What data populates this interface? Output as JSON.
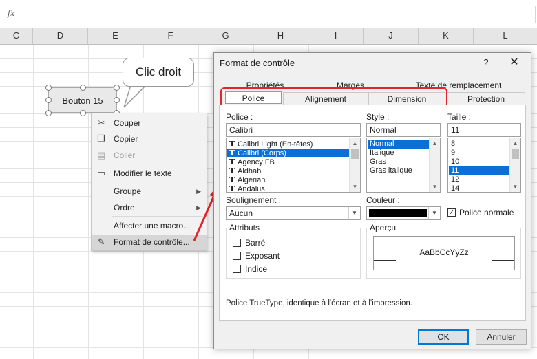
{
  "formula_bar": {
    "fx_label": "fx"
  },
  "columns": [
    {
      "label": "C",
      "left": 0
    },
    {
      "label": "D"
    },
    {
      "label": "E"
    },
    {
      "label": "F"
    },
    {
      "label": "G"
    },
    {
      "label": "H"
    },
    {
      "label": "I"
    },
    {
      "label": "J"
    },
    {
      "label": "K"
    },
    {
      "label": "L"
    }
  ],
  "sheet_button": {
    "label": "Bouton 15"
  },
  "callout": {
    "text": "Clic droit"
  },
  "context_menu": {
    "cut": "Couper",
    "copy": "Copier",
    "paste": "Coller",
    "edit_text": "Modifier le texte",
    "group": "Groupe",
    "order": "Ordre",
    "assign_macro": "Affecter une macro...",
    "format_control": "Format de contrôle..."
  },
  "dialog": {
    "title": "Format de contrôle",
    "help": "?",
    "close": "✕",
    "tabs_row1": [
      "Propriétés",
      "Marges",
      "Texte de remplacement"
    ],
    "tabs_row2": [
      "Police",
      "Alignement",
      "Dimension",
      "Protection"
    ],
    "font_label": "Police :",
    "font_value": "Calibri",
    "font_list": [
      "Calibri Light (En-têtes)",
      "Calibri (Corps)",
      "Agency FB",
      "Aldhabi",
      "Algerian",
      "Andalus"
    ],
    "style_label": "Style :",
    "style_value": "Normal",
    "style_list": [
      "Normal",
      "Italique",
      "Gras",
      "Gras italique"
    ],
    "size_label": "Taille :",
    "size_value": "11",
    "size_list": [
      "8",
      "9",
      "10",
      "11",
      "12",
      "14"
    ],
    "underline_label": "Soulignement :",
    "underline_value": "Aucun",
    "color_label": "Couleur :",
    "color_value": "#000000",
    "normal_font_label": "Police normale",
    "effects_label": "Attributs",
    "strikethrough": "Barré",
    "superscript": "Exposant",
    "subscript": "Indice",
    "preview_label": "Aperçu",
    "preview_text": "AaBbCcYyZz",
    "info_text": "Police TrueType, identique à l'écran et à l'impression.",
    "ok": "OK",
    "cancel": "Annuler"
  },
  "colors": {
    "highlight_red": "#e2242b",
    "selection_blue": "#0a6fd6"
  }
}
